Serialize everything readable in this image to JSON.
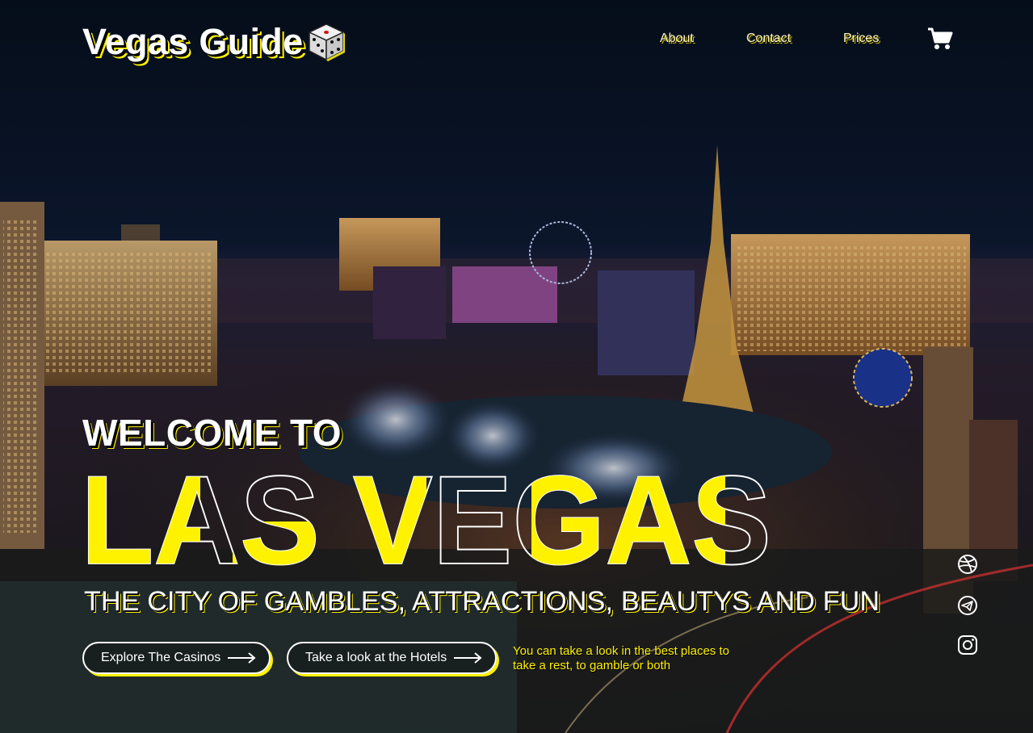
{
  "brand": {
    "name": "Vegas Guide",
    "dice_icon": "dice-icon",
    "accent_color": "#fff200"
  },
  "nav": {
    "items": [
      {
        "label": "About"
      },
      {
        "label": "Contact"
      },
      {
        "label": "Prices"
      }
    ],
    "cart_icon": "cart-icon"
  },
  "hero": {
    "welcome": "WELCOME TO",
    "title": "LAS VEGAS",
    "tagline": "THE CITY OF GAMBLES, ATTRACTIONS, BEAUTYS AND FUN",
    "buttons": [
      {
        "label": "Explore The Casinos",
        "icon": "arrow-right-icon"
      },
      {
        "label": "Take a look at the Hotels",
        "icon": "arrow-right-icon"
      }
    ],
    "note": "You can take a look in the best places to take a rest, to gamble or both"
  },
  "social": [
    {
      "icon": "dribbble-icon"
    },
    {
      "icon": "telegram-icon"
    },
    {
      "icon": "instagram-icon"
    }
  ]
}
